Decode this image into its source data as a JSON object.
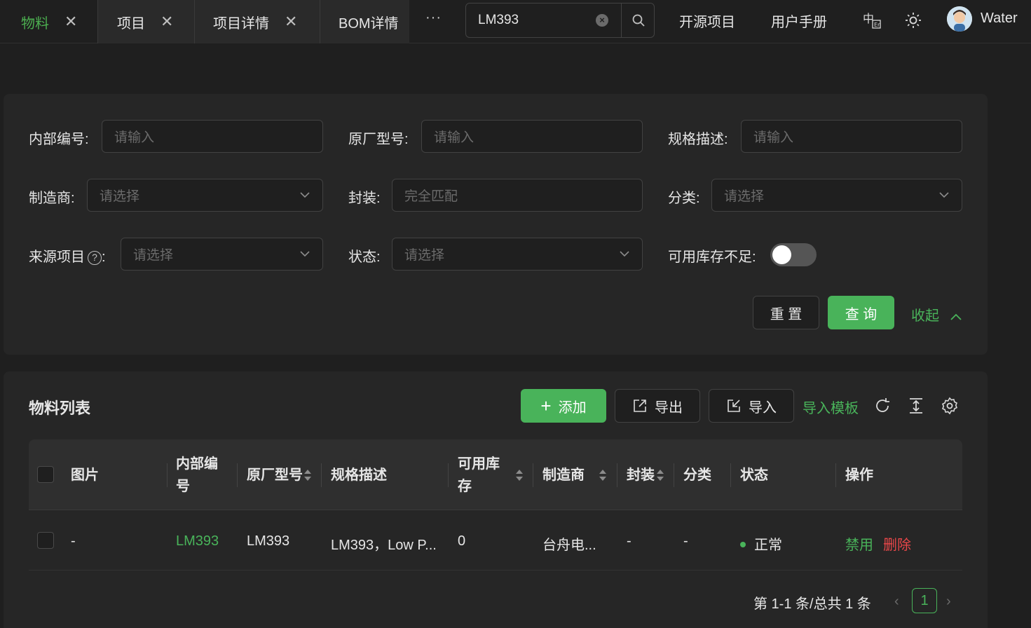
{
  "tabs": [
    {
      "label": "物料",
      "active": true
    },
    {
      "label": "项目"
    },
    {
      "label": "项目详情"
    },
    {
      "label": "BOM详情"
    }
  ],
  "tabs_more": "···",
  "search": {
    "value": "LM393"
  },
  "nav": {
    "open_source": "开源项目",
    "manual": "用户手册",
    "username": "Water"
  },
  "filters": {
    "internal_code": {
      "label": "内部编号:",
      "placeholder": "请输入"
    },
    "mfr_part": {
      "label": "原厂型号:",
      "placeholder": "请输入"
    },
    "spec": {
      "label": "规格描述:",
      "placeholder": "请输入"
    },
    "manufacturer": {
      "label": "制造商:",
      "placeholder": "请选择"
    },
    "package": {
      "label": "封装:",
      "placeholder": "完全匹配"
    },
    "category": {
      "label": "分类:",
      "placeholder": "请选择"
    },
    "source_project": {
      "label": "来源项目",
      "placeholder": "请选择"
    },
    "status": {
      "label": "状态:",
      "placeholder": "请选择"
    },
    "low_stock": {
      "label": "可用库存不足:",
      "on": false
    },
    "reset": "重 置",
    "query": "查 询",
    "collapse": "收起"
  },
  "list": {
    "title": "物料列表",
    "add": "添加",
    "export": "导出",
    "import": "导入",
    "template": "导入模板"
  },
  "table": {
    "headers": {
      "image": "图片",
      "internal_code_1": "内部编",
      "internal_code_2": "号",
      "mfr_part": "原厂型号",
      "spec": "规格描述",
      "stock_1": "可用库",
      "stock_2": "存",
      "manufacturer": "制造商",
      "package": "封装",
      "category": "分类",
      "status": "状态",
      "actions": "操作"
    },
    "rows": [
      {
        "image": "-",
        "internal_code": "LM393",
        "mfr_part": "LM393",
        "spec": "LM393，Low P...",
        "stock": "0",
        "manufacturer": "台舟电...",
        "package": "-",
        "category": "-",
        "status": "正常",
        "disable": "禁用",
        "delete": "删除"
      }
    ]
  },
  "pagination": {
    "summary": "第 1-1 条/总共 1 条",
    "current": "1"
  },
  "colors": {
    "accent": "#49b35a",
    "danger": "#e84749",
    "background": "#1f1f1f",
    "card": "#262626"
  }
}
